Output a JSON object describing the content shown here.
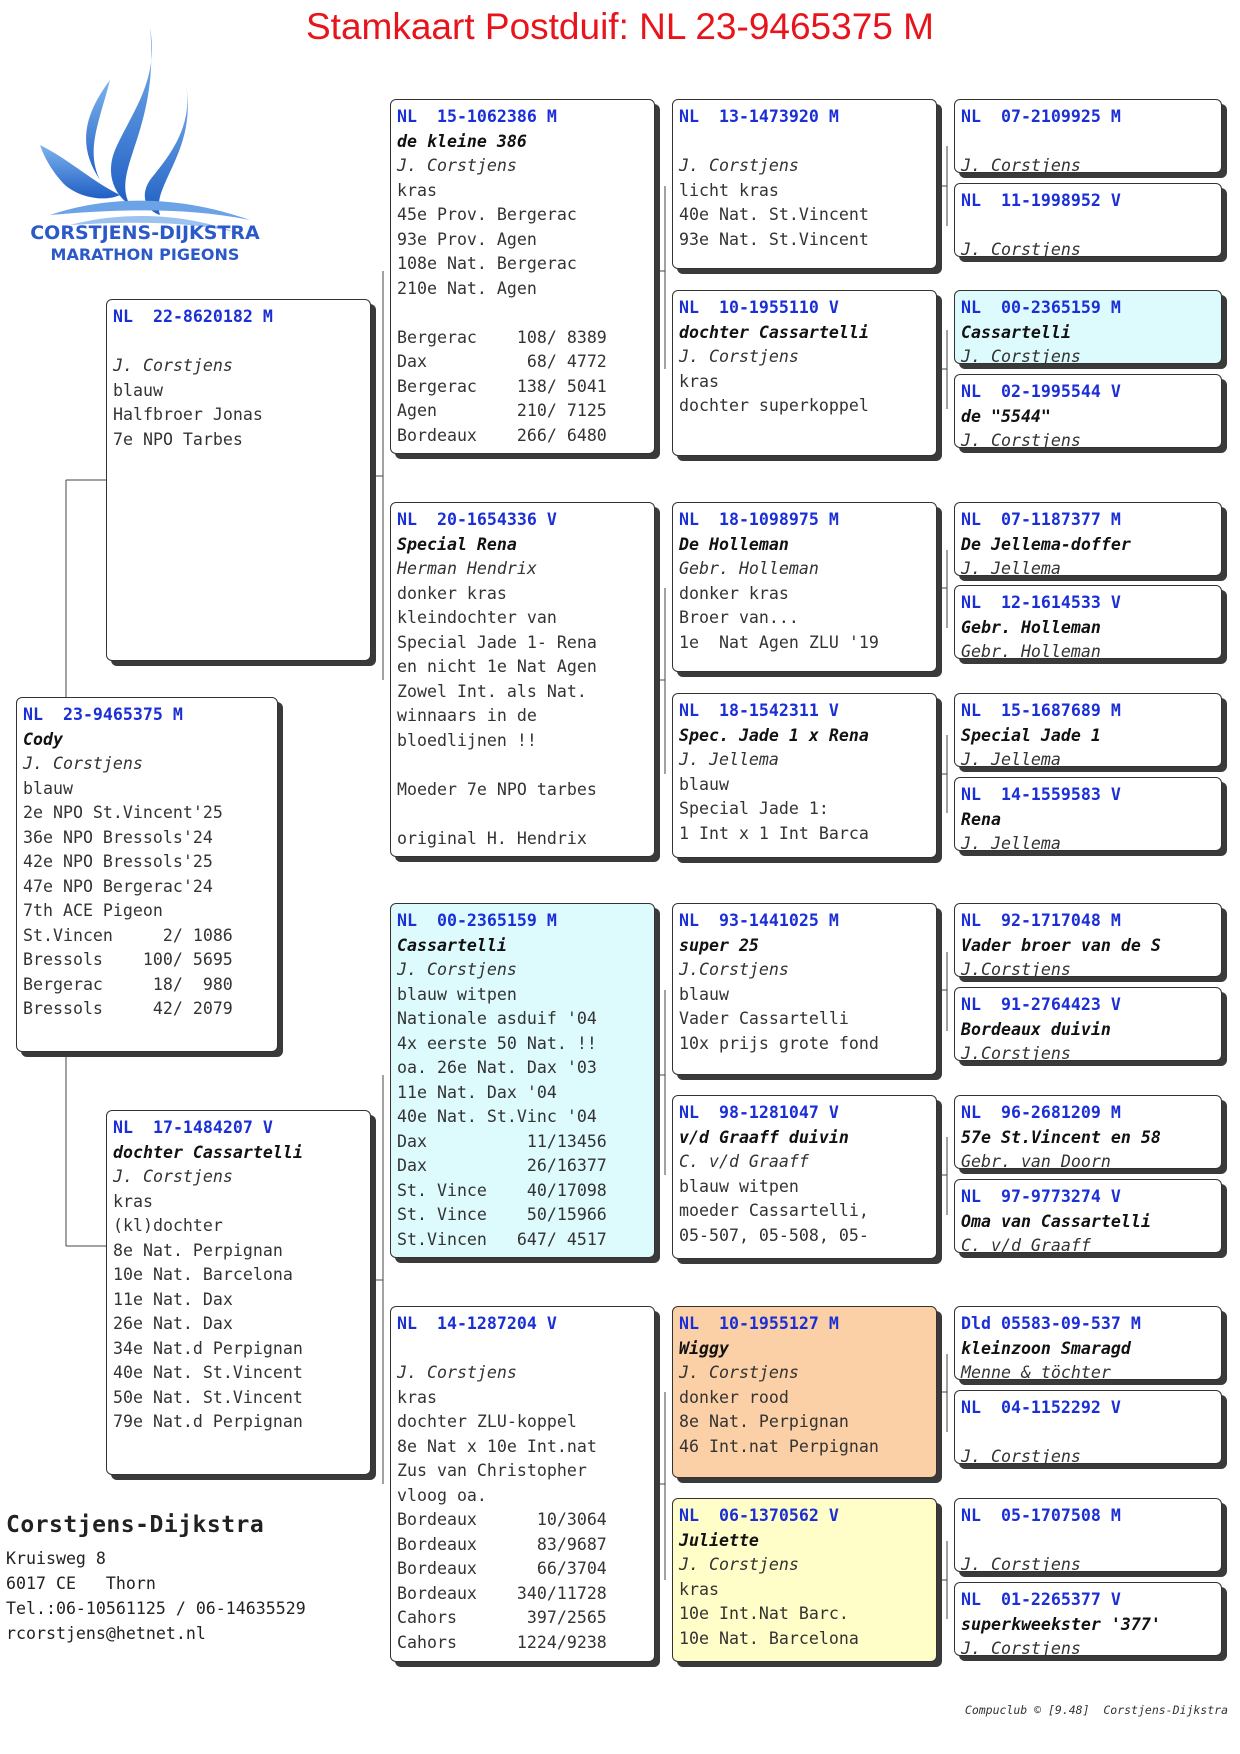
{
  "title": "Stamkaart Postduif: NL  23-9465375 M",
  "logo": {
    "line1": "CORSTJENS-DIJKSTRA",
    "line2": "MARATHON PIGEONS"
  },
  "colors": {
    "title": "#e8141c",
    "ring": "#1b2fd6",
    "cyan": "#ddfafd",
    "orange": "#fbd0a6",
    "yellow": "#fffdc8"
  },
  "contact": {
    "name": "Corstjens-Dijkstra",
    "lines": [
      "Kruisweg 8",
      "6017 CE   Thorn",
      "Tel.:06-10561125 / 06-14635529",
      "rcorstjens@hetnet.nl"
    ]
  },
  "footer": "Compuclub © [9.48]  Corstjens-Dijkstra",
  "birds": {
    "subject": {
      "ring": "NL  23-9465375 M",
      "name": "Cody",
      "owner": "J. Corstjens",
      "lines": [
        "blauw",
        "2e NPO St.Vincent'25",
        "36e NPO Bressols'24",
        "42e NPO Bressols'25",
        "47e NPO Bergerac'24",
        "7th ACE Pigeon",
        "St.Vincen     2/ 1086",
        "Bressols    100/ 5695",
        "Bergerac     18/  980",
        "Bressols     42/ 2079"
      ]
    },
    "f": {
      "ring": "NL  22-8620182 M",
      "name": "",
      "owner": "J. Corstjens",
      "lines": [
        "blauw",
        "Halfbroer Jonas",
        "7e NPO Tarbes"
      ]
    },
    "m": {
      "ring": "NL  17-1484207 V",
      "name": "dochter Cassartelli",
      "owner": "J. Corstjens",
      "lines": [
        "kras",
        "(kl)dochter",
        "8e Nat. Perpignan",
        "10e Nat. Barcelona",
        "11e Nat. Dax",
        "26e Nat. Dax",
        "34e Nat.d Perpignan",
        "40e Nat. St.Vincent",
        "50e Nat. St.Vincent",
        "79e Nat.d Perpignan"
      ]
    },
    "ff": {
      "ring": "NL  15-1062386 M",
      "name": "de kleine 386",
      "owner": "J. Corstjens",
      "lines": [
        "kras",
        "45e Prov. Bergerac",
        "93e Prov. Agen",
        "108e Nat. Bergerac",
        "210e Nat. Agen",
        "",
        "Bergerac    108/ 8389",
        "Dax          68/ 4772",
        "Bergerac    138/ 5041",
        "Agen        210/ 7125",
        "Bordeaux    266/ 6480"
      ]
    },
    "fm": {
      "ring": "NL  20-1654336 V",
      "name": "Special Rena",
      "owner": "Herman Hendrix",
      "lines": [
        "donker kras",
        "kleindochter van",
        "Special Jade 1- Rena",
        "en nicht 1e Nat Agen",
        "Zowel Int. als Nat.",
        "winnaars in de",
        "bloedlijnen !!",
        "",
        "Moeder 7e NPO tarbes",
        "",
        "original H. Hendrix"
      ]
    },
    "mf": {
      "ring": "NL  00-2365159 M",
      "name": "Cassartelli",
      "owner": "J. Corstjens",
      "lines": [
        "blauw witpen",
        "Nationale asduif '04",
        "4x eerste 50 Nat. !!",
        "oa. 26e Nat. Dax '03",
        "11e Nat. Dax '04",
        "40e Nat. St.Vinc '04",
        "Dax          11/13456",
        "Dax          26/16377",
        "St. Vince    40/17098",
        "St. Vince    50/15966",
        "St.Vincen   647/ 4517"
      ]
    },
    "mm": {
      "ring": "NL  14-1287204 V",
      "name": "",
      "owner": "J. Corstjens",
      "lines": [
        "kras",
        "dochter ZLU-koppel",
        "8e Nat x 10e Int.nat",
        "Zus van Christopher",
        "vloog oa.",
        "Bordeaux      10/3064",
        "Bordeaux      83/9687",
        "Bordeaux      66/3704",
        "Bordeaux    340/11728",
        "Cahors       397/2565",
        "Cahors      1224/9238"
      ]
    },
    "fff": {
      "ring": "NL  13-1473920 M",
      "name": "",
      "owner": "J. Corstjens",
      "lines": [
        "licht kras",
        "40e Nat. St.Vincent",
        "93e Nat. St.Vincent"
      ]
    },
    "ffm": {
      "ring": "NL  10-1955110 V",
      "name": "dochter Cassartelli",
      "owner": "J. Corstjens",
      "lines": [
        "kras",
        "dochter superkoppel"
      ]
    },
    "fmf": {
      "ring": "NL  18-1098975 M",
      "name": "De Holleman",
      "owner": "Gebr. Holleman",
      "lines": [
        "donker kras",
        "Broer van...",
        "1e  Nat Agen ZLU '19"
      ]
    },
    "fmm": {
      "ring": "NL  18-1542311 V",
      "name": "Spec. Jade 1 x Rena",
      "owner": "J. Jellema",
      "lines": [
        "blauw",
        "Special Jade 1:",
        "1 Int x 1 Int Barca"
      ]
    },
    "mff": {
      "ring": "NL  93-1441025 M",
      "name": "super 25",
      "owner": "J.Corstjens",
      "lines": [
        "blauw",
        "Vader Cassartelli",
        "10x prijs grote fond"
      ]
    },
    "mfm": {
      "ring": "NL  98-1281047 V",
      "name": "v/d Graaff duivin",
      "owner": "C. v/d Graaff",
      "lines": [
        "blauw witpen",
        "moeder Cassartelli,",
        "05-507, 05-508, 05-"
      ]
    },
    "mmf": {
      "ring": "NL  10-1955127 M",
      "name": "Wiggy",
      "owner": "J. Corstjens",
      "lines": [
        "donker rood",
        "8e Nat. Perpignan",
        "46 Int.nat Perpignan"
      ]
    },
    "mmm": {
      "ring": "NL  06-1370562 V",
      "name": "Juliette",
      "owner": "J. Corstjens",
      "lines": [
        "kras",
        "10e Int.Nat Barc.",
        "10e Nat. Barcelona"
      ]
    },
    "ffff": {
      "ring": "NL  07-2109925 M",
      "name": "",
      "owner": "J. Corstjens",
      "lines": []
    },
    "fffm": {
      "ring": "NL  11-1998952 V",
      "name": "",
      "owner": "J. Corstjens",
      "lines": []
    },
    "ffmf": {
      "ring": "NL  00-2365159 M",
      "name": "Cassartelli",
      "owner": "J. Corstjens",
      "lines": []
    },
    "ffmm": {
      "ring": "NL  02-1995544 V",
      "name": "de \"5544\"",
      "owner": "J. Corstjens",
      "lines": []
    },
    "fmff": {
      "ring": "NL  07-1187377 M",
      "name": "De Jellema-doffer",
      "owner": "J. Jellema",
      "lines": []
    },
    "fmfm": {
      "ring": "NL  12-1614533 V",
      "name": "Gebr. Holleman",
      "owner": "Gebr. Holleman",
      "lines": []
    },
    "fmmf": {
      "ring": "NL  15-1687689 M",
      "name": "Special Jade 1",
      "owner": "J. Jellema",
      "lines": []
    },
    "fmmm": {
      "ring": "NL  14-1559583 V",
      "name": "Rena",
      "owner": "J. Jellema",
      "lines": []
    },
    "mfff": {
      "ring": "NL  92-1717048 M",
      "name": "Vader broer van de S",
      "owner": "J.Corstjens",
      "lines": []
    },
    "mffm": {
      "ring": "NL  91-2764423 V",
      "name": "Bordeaux duivin",
      "owner": "J.Corstjens",
      "lines": []
    },
    "mfmf": {
      "ring": "NL  96-2681209 M",
      "name": "57e St.Vincent en 58",
      "owner": "Gebr. van Doorn",
      "lines": []
    },
    "mfmm": {
      "ring": "NL  97-9773274 V",
      "name": "Oma van Cassartelli",
      "owner": "C. v/d Graaff",
      "lines": []
    },
    "mmff": {
      "ring": "Dld 05583-09-537 M",
      "name": "kleinzoon Smaragd",
      "owner": "Menne & töchter",
      "lines": []
    },
    "mmfm": {
      "ring": "NL  04-1152292 V",
      "name": "",
      "owner": "J. Corstjens",
      "lines": []
    },
    "mmmf": {
      "ring": "NL  05-1707508 M",
      "name": "",
      "owner": "J. Corstjens",
      "lines": []
    },
    "mmmm": {
      "ring": "NL  01-2265377 V",
      "name": "superkweekster '377'",
      "owner": "J. Corstjens",
      "lines": []
    }
  }
}
